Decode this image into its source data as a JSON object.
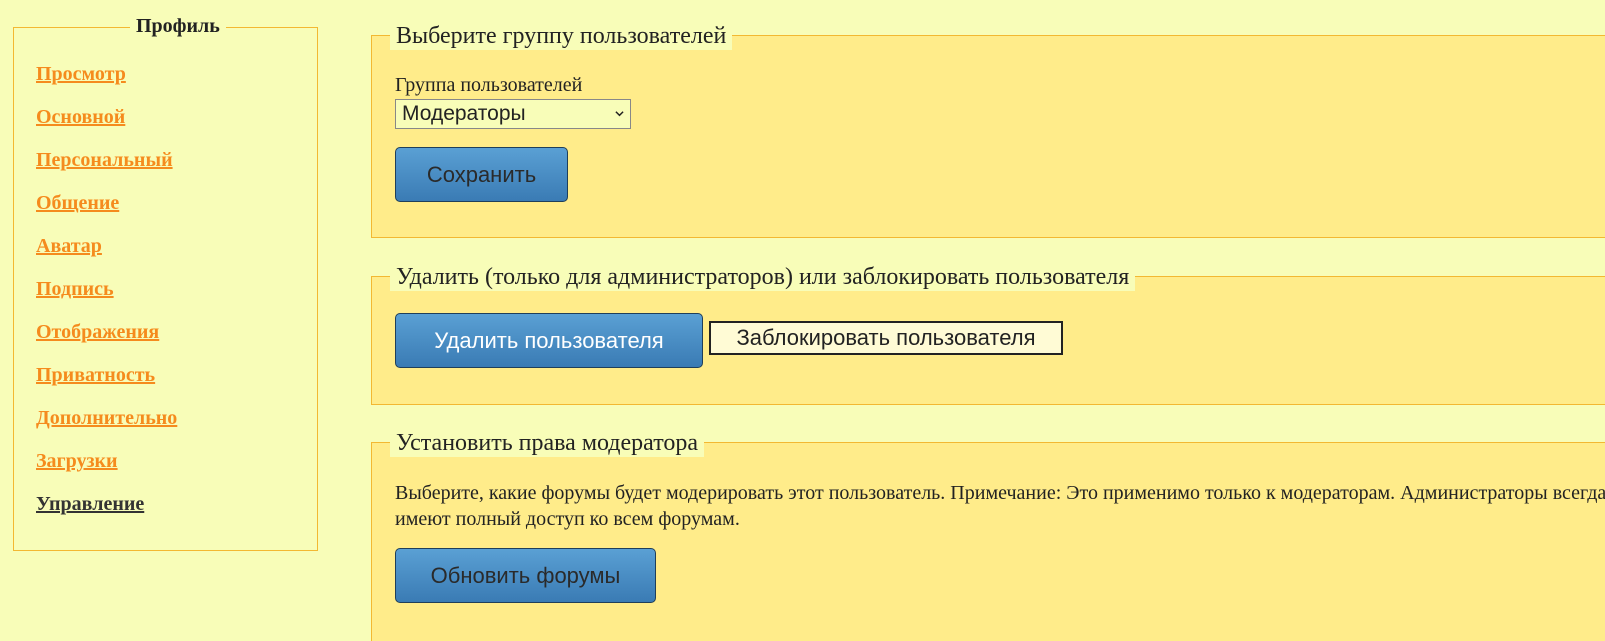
{
  "sidebar": {
    "title": "Профиль",
    "items": [
      {
        "label": "Просмотр"
      },
      {
        "label": "Основной"
      },
      {
        "label": "Персональный"
      },
      {
        "label": "Общение"
      },
      {
        "label": "Аватар"
      },
      {
        "label": "Подпись"
      },
      {
        "label": "Отображения"
      },
      {
        "label": "Приватность"
      },
      {
        "label": "Дополнительно"
      },
      {
        "label": "Загрузки"
      },
      {
        "label": "Управление"
      }
    ],
    "active_item": "Управление"
  },
  "group_section": {
    "legend": "Выберите группу пользователей",
    "field_label": "Группа пользователей",
    "selected_group": "Модераторы",
    "save_label": "Сохранить"
  },
  "delete_section": {
    "legend": "Удалить (только для администраторов) или заблокировать пользователя",
    "delete_label": "Удалить пользователя",
    "ban_label": "Заблокировать пользователя"
  },
  "moderator_section": {
    "legend": "Установить права модератора",
    "description": "Выберите, какие форумы будет модерировать этот пользователь. Примечание: Это применимо только к модераторам. Администраторы всегда имеют полный доступ ко всем форумам.",
    "update_label": "Обновить форумы"
  },
  "colors": {
    "background": "#f8fdb8",
    "panel": "#ffec8a",
    "border": "#f3b832",
    "link": "#f58b1d",
    "button": "#3a7bb4"
  },
  "icons": {
    "select_arrow": "chevron-down-icon"
  }
}
